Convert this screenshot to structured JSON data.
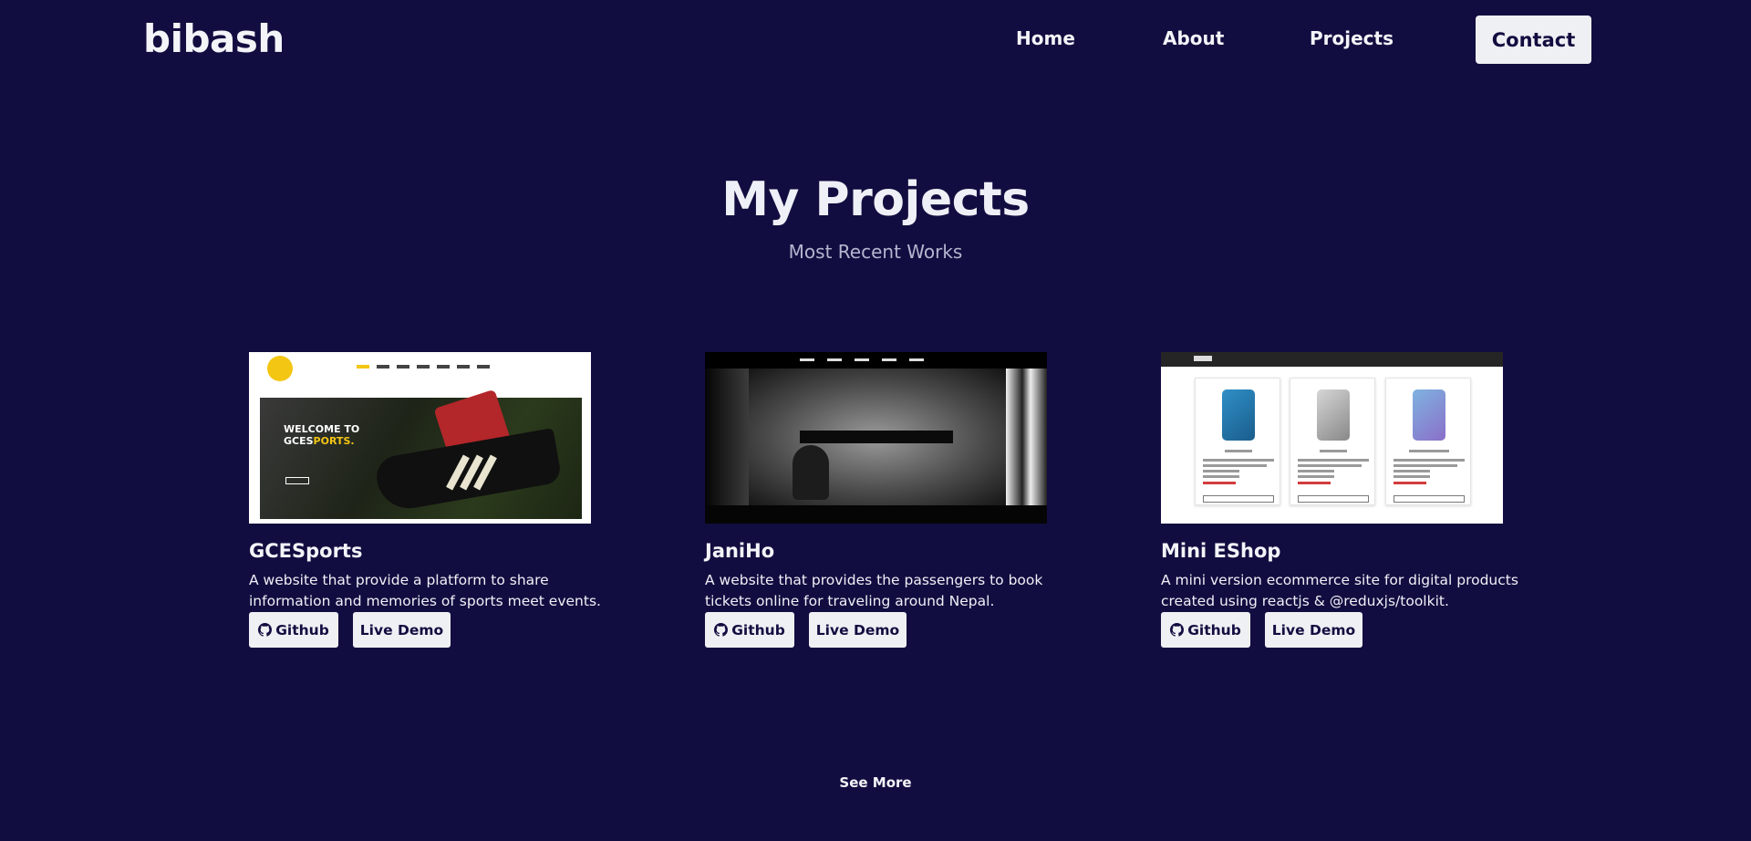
{
  "header": {
    "logo": "bibash",
    "nav": {
      "home": "Home",
      "about": "About",
      "projects": "Projects",
      "contact": "Contact"
    }
  },
  "projects_section": {
    "title": "My Projects",
    "subtitle": "Most Recent Works",
    "cards": [
      {
        "title": "GCESports",
        "description": "A website that provide a platform to share information and memories of sports meet events.",
        "github_label": "Github",
        "demo_label": "Live Demo",
        "thumbnail_text_1": "WELCOME TO",
        "thumbnail_text_2": "GCES",
        "thumbnail_text_3": "PORTS."
      },
      {
        "title": "JaniHo",
        "description": "A website that provides the passengers to book tickets online for traveling around Nepal.",
        "github_label": "Github",
        "demo_label": "Live Demo"
      },
      {
        "title": "Mini EShop",
        "description": "A mini version ecommerce site for digital products created using reactjs & @reduxjs/toolkit.",
        "github_label": "Github",
        "demo_label": "Live Demo"
      }
    ],
    "see_more": "See More"
  },
  "colors": {
    "background": "#120d40",
    "button_bg": "#eef0f4",
    "button_text": "#120d40",
    "subtitle": "#b4b6cf"
  },
  "icons": {
    "github": "github-icon"
  }
}
